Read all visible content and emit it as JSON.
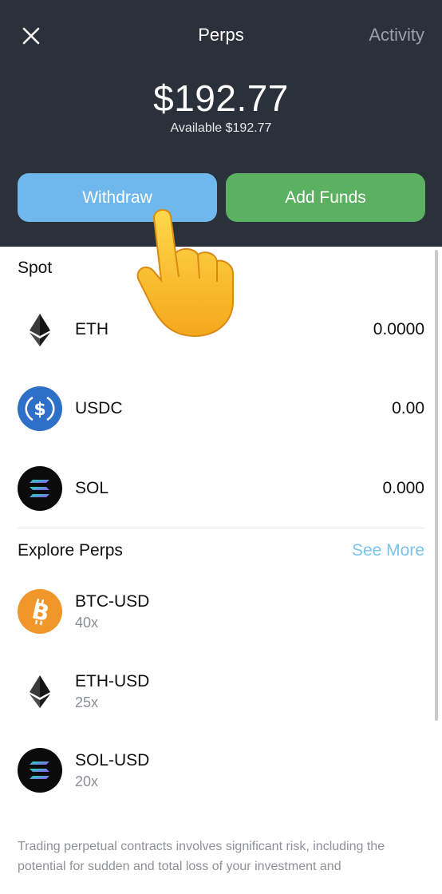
{
  "header": {
    "close_icon": "close-icon",
    "title": "Perps",
    "activity_label": "Activity",
    "balance": "$192.77",
    "available": "Available $192.77",
    "withdraw_label": "Withdraw",
    "add_funds_label": "Add Funds",
    "background_color": "#2b313a",
    "withdraw_color": "#6fb8ee",
    "add_funds_color": "#5cb062"
  },
  "spot": {
    "title": "Spot",
    "items": [
      {
        "asset": "ETH",
        "amount": "0.0000",
        "icon": "eth-icon"
      },
      {
        "asset": "USDC",
        "amount": "0.00",
        "icon": "usdc-icon"
      },
      {
        "asset": "SOL",
        "amount": "0.000",
        "icon": "sol-icon"
      }
    ]
  },
  "explore": {
    "title": "Explore Perps",
    "see_more_label": "See More",
    "see_more_color": "#7ac3ee",
    "items": [
      {
        "name": "BTC-USD",
        "leverage": "40x",
        "icon": "btc-icon"
      },
      {
        "name": "ETH-USD",
        "leverage": "25x",
        "icon": "eth-icon"
      },
      {
        "name": "SOL-USD",
        "leverage": "20x",
        "icon": "sol-icon"
      }
    ]
  },
  "disclaimer": "Trading perpetual contracts involves significant risk, including the potential for sudden and total loss of your investment and",
  "overlay": {
    "icon": "pointing-hand-icon"
  }
}
